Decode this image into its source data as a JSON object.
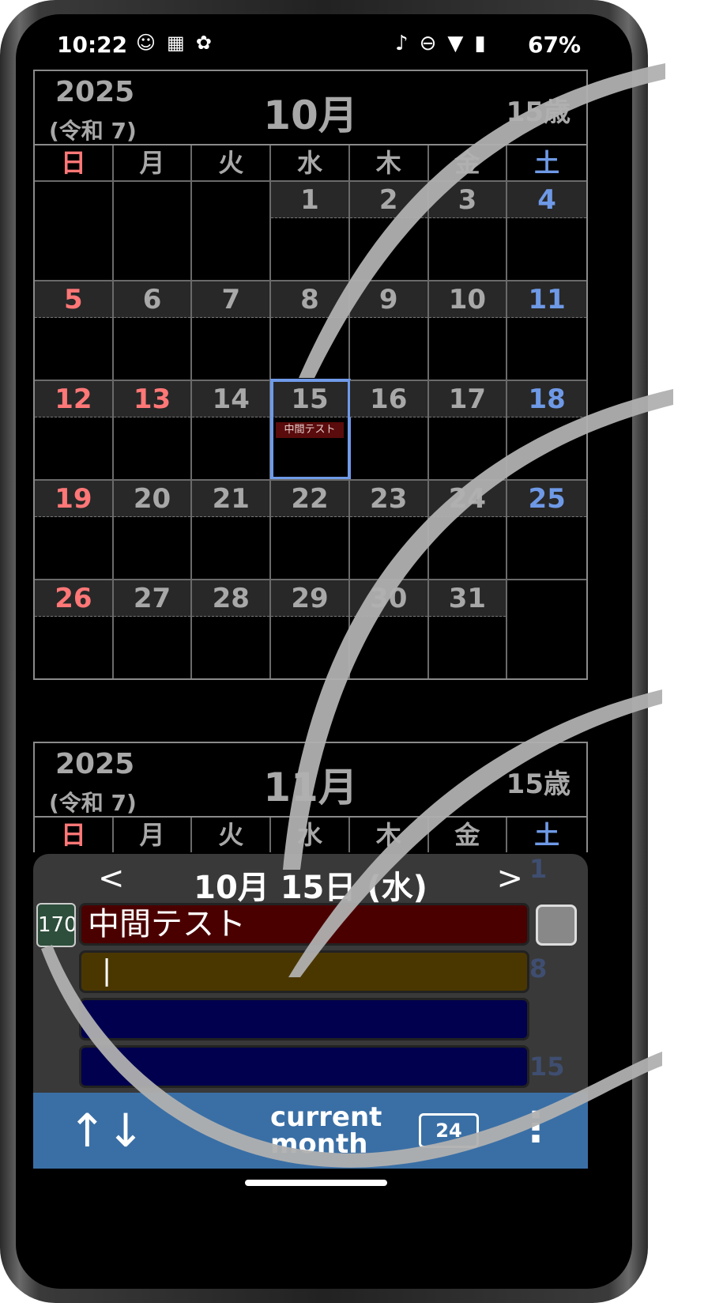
{
  "status": {
    "time": "10:22",
    "left_icons": [
      "notification-icon",
      "calendar-31-icon",
      "openai-icon"
    ],
    "right_icons": [
      "bell-off-icon",
      "do-not-disturb-icon",
      "wifi-icon",
      "battery-icon"
    ],
    "battery": "67%"
  },
  "months": [
    {
      "year": "2025",
      "era": "(令和 7)",
      "month": "10月",
      "age": "15歳",
      "weekdays": [
        "日",
        "月",
        "火",
        "水",
        "木",
        "金",
        "土"
      ],
      "days": [
        "",
        "",
        "",
        "1",
        "2",
        "3",
        "4",
        "5",
        "6",
        "7",
        "8",
        "9",
        "10",
        "11",
        "12",
        "13",
        "14",
        "15",
        "16",
        "17",
        "18",
        "19",
        "20",
        "21",
        "22",
        "23",
        "24",
        "25",
        "26",
        "27",
        "28",
        "29",
        "30",
        "31",
        ""
      ],
      "holidays": [
        "13"
      ],
      "selected": "15",
      "event_label": "中間テスト"
    },
    {
      "year": "2025",
      "era": "(令和 7)",
      "month": "11月",
      "age": "15歳",
      "weekdays": [
        "日",
        "月",
        "火",
        "水",
        "木",
        "金",
        "土"
      ]
    }
  ],
  "panel": {
    "prev": "<",
    "next": ">",
    "date": "10月 15日 (水)",
    "badge": "170",
    "slots": [
      "中間テスト",
      "|",
      "",
      ""
    ],
    "bg_numbers": [
      "1",
      "8",
      "15"
    ]
  },
  "bottom": {
    "sort_icon": "↑↓",
    "current_month": "current month",
    "calendar_badge": "24",
    "more_icon": "⋮"
  },
  "colors": {
    "sunday": "#ff7777",
    "saturday": "#6e99e6",
    "selection": "#6f9ae8",
    "bar": "#3a6fa5",
    "slot_red": "#4b0000",
    "slot_brown": "#4a3700",
    "slot_blue": "#00004e"
  }
}
